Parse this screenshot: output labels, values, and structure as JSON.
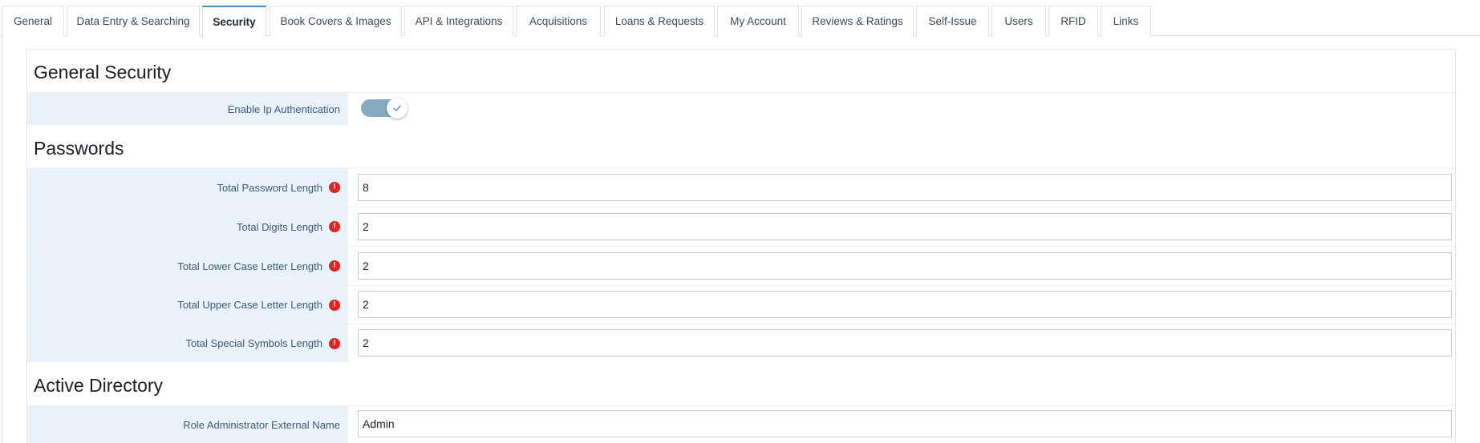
{
  "tabs": [
    {
      "label": "General"
    },
    {
      "label": "Data Entry & Searching"
    },
    {
      "label": "Security"
    },
    {
      "label": "Book Covers & Images"
    },
    {
      "label": "API & Integrations"
    },
    {
      "label": "Acquisitions"
    },
    {
      "label": "Loans & Requests"
    },
    {
      "label": "My Account"
    },
    {
      "label": "Reviews & Ratings"
    },
    {
      "label": "Self-Issue"
    },
    {
      "label": "Users"
    },
    {
      "label": "RFID"
    },
    {
      "label": "Links"
    }
  ],
  "active_tab": "Security",
  "sections": {
    "general_security": {
      "title": "General Security",
      "enable_ip_auth": {
        "label": "Enable Ip Authentication",
        "enabled": true
      }
    },
    "passwords": {
      "title": "Passwords",
      "fields": [
        {
          "label": "Total Password Length",
          "value": "8",
          "required": true
        },
        {
          "label": "Total Digits Length",
          "value": "2",
          "required": true
        },
        {
          "label": "Total Lower Case Letter Length",
          "value": "2",
          "required": true
        },
        {
          "label": "Total Upper Case Letter Length",
          "value": "2",
          "required": true
        },
        {
          "label": "Total Special Symbols Length",
          "value": "2",
          "required": true
        }
      ]
    },
    "active_directory": {
      "title": "Active Directory",
      "role_admin": {
        "label": "Role Administrator External Name",
        "value": "Admin"
      }
    }
  },
  "required_icon": "exclamation-circle-icon",
  "colors": {
    "accent": "#3b8fd0",
    "required": "#e02424",
    "label_bg": "#eaf2f9",
    "toggle": "#86aac4"
  }
}
